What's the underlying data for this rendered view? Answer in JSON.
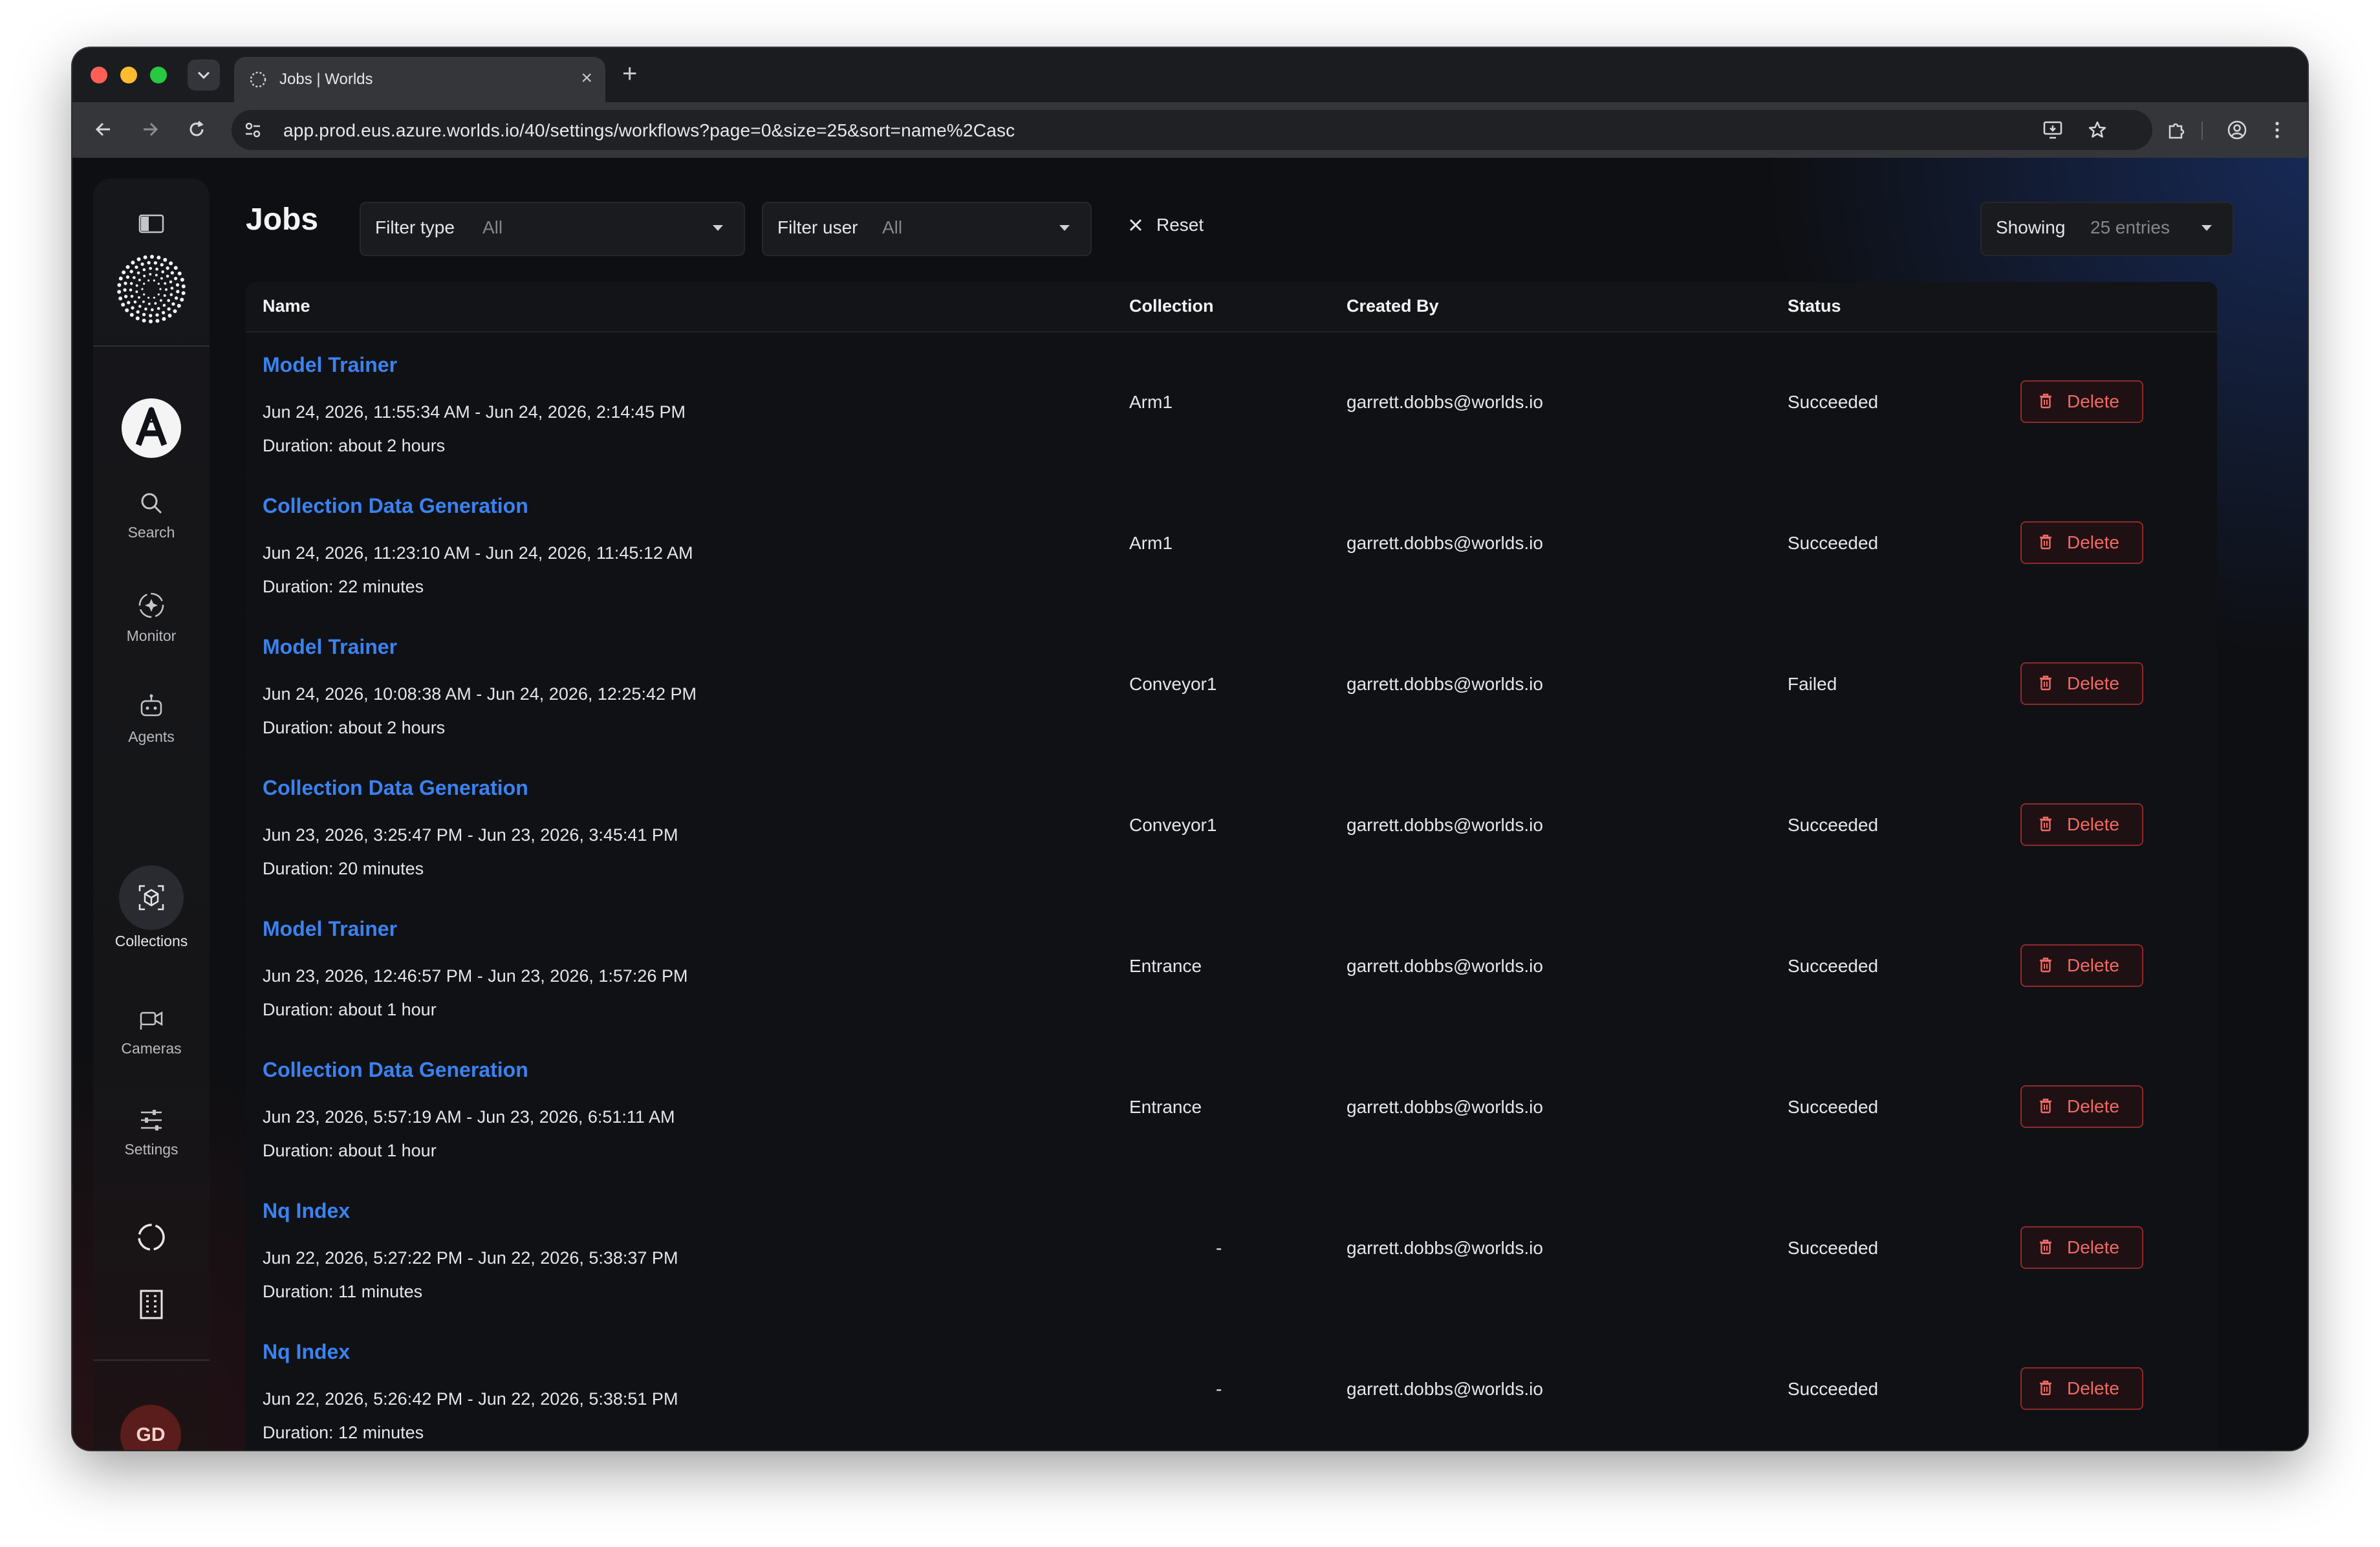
{
  "browser": {
    "tab_title": "Jobs | Worlds",
    "url": "app.prod.eus.azure.worlds.io/40/settings/workflows?page=0&size=25&sort=name%2Casc"
  },
  "sidebar": {
    "items": [
      {
        "label": "Search",
        "icon": "search-icon"
      },
      {
        "label": "Monitor",
        "icon": "monitor-icon"
      },
      {
        "label": "Agents",
        "icon": "robot-icon"
      },
      {
        "label": "Collections",
        "icon": "cube-icon"
      },
      {
        "label": "Cameras",
        "icon": "camera-icon"
      },
      {
        "label": "Settings",
        "icon": "sliders-icon"
      }
    ],
    "avatar_initials": "GD"
  },
  "header": {
    "title": "Jobs",
    "filter_type": {
      "label": "Filter type",
      "value": "All"
    },
    "filter_user": {
      "label": "Filter user",
      "value": "All"
    },
    "reset_label": "Reset",
    "showing": {
      "label": "Showing",
      "value": "25 entries"
    }
  },
  "table": {
    "columns": [
      "Name",
      "Collection",
      "Created By",
      "Status"
    ],
    "delete_label": "Delete",
    "rows": [
      {
        "name": "Model Trainer",
        "range": "Jun 24, 2026, 11:55:34 AM - Jun 24, 2026, 2:14:45 PM",
        "duration": "Duration: about 2 hours",
        "collection": "Arm1",
        "created_by": "garrett.dobbs@worlds.io",
        "status": "Succeeded"
      },
      {
        "name": "Collection Data Generation",
        "range": "Jun 24, 2026, 11:23:10 AM - Jun 24, 2026, 11:45:12 AM",
        "duration": "Duration: 22 minutes",
        "collection": "Arm1",
        "created_by": "garrett.dobbs@worlds.io",
        "status": "Succeeded"
      },
      {
        "name": "Model Trainer",
        "range": "Jun 24, 2026, 10:08:38 AM - Jun 24, 2026, 12:25:42 PM",
        "duration": "Duration: about 2 hours",
        "collection": "Conveyor1",
        "created_by": "garrett.dobbs@worlds.io",
        "status": "Failed"
      },
      {
        "name": "Collection Data Generation",
        "range": "Jun 23, 2026, 3:25:47 PM - Jun 23, 2026, 3:45:41 PM",
        "duration": "Duration: 20 minutes",
        "collection": "Conveyor1",
        "created_by": "garrett.dobbs@worlds.io",
        "status": "Succeeded"
      },
      {
        "name": "Model Trainer",
        "range": "Jun 23, 2026, 12:46:57 PM - Jun 23, 2026, 1:57:26 PM",
        "duration": "Duration: about 1 hour",
        "collection": "Entrance",
        "created_by": "garrett.dobbs@worlds.io",
        "status": "Succeeded"
      },
      {
        "name": "Collection Data Generation",
        "range": "Jun 23, 2026, 5:57:19 AM - Jun 23, 2026, 6:51:11 AM",
        "duration": "Duration: about 1 hour",
        "collection": "Entrance",
        "created_by": "garrett.dobbs@worlds.io",
        "status": "Succeeded"
      },
      {
        "name": "Nq Index",
        "range": "Jun 22, 2026, 5:27:22 PM - Jun 22, 2026, 5:38:37 PM",
        "duration": "Duration: 11 minutes",
        "collection": "-",
        "created_by": "garrett.dobbs@worlds.io",
        "status": "Succeeded"
      },
      {
        "name": "Nq Index",
        "range": "Jun 22, 2026, 5:26:42 PM - Jun 22, 2026, 5:38:51 PM",
        "duration": "Duration: 12 minutes",
        "collection": "-",
        "created_by": "garrett.dobbs@worlds.io",
        "status": "Succeeded"
      }
    ]
  },
  "colors": {
    "link": "#3a82f0",
    "danger": "#ef6a64",
    "background": "#0e0f12"
  }
}
